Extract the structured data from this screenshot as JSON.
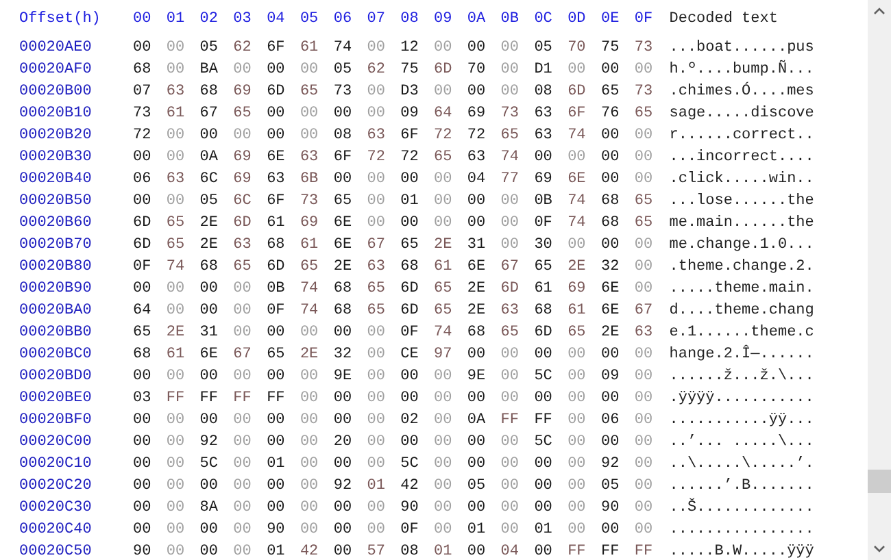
{
  "header": {
    "offset": "Offset(h)",
    "columns": [
      "00",
      "01",
      "02",
      "03",
      "04",
      "05",
      "06",
      "07",
      "08",
      "09",
      "0A",
      "0B",
      "0C",
      "0D",
      "0E",
      "0F"
    ],
    "decoded": "Decoded text"
  },
  "rows": [
    {
      "offset": "00020AE0",
      "bytes": [
        "00",
        "00",
        "05",
        "62",
        "6F",
        "61",
        "74",
        "00",
        "12",
        "00",
        "00",
        "00",
        "05",
        "70",
        "75",
        "73"
      ],
      "text": "...boat......pus"
    },
    {
      "offset": "00020AF0",
      "bytes": [
        "68",
        "00",
        "BA",
        "00",
        "00",
        "00",
        "05",
        "62",
        "75",
        "6D",
        "70",
        "00",
        "D1",
        "00",
        "00",
        "00"
      ],
      "text": "h.º....bump.Ñ..."
    },
    {
      "offset": "00020B00",
      "bytes": [
        "07",
        "63",
        "68",
        "69",
        "6D",
        "65",
        "73",
        "00",
        "D3",
        "00",
        "00",
        "00",
        "08",
        "6D",
        "65",
        "73"
      ],
      "text": ".chimes.Ó....mes"
    },
    {
      "offset": "00020B10",
      "bytes": [
        "73",
        "61",
        "67",
        "65",
        "00",
        "00",
        "00",
        "00",
        "09",
        "64",
        "69",
        "73",
        "63",
        "6F",
        "76",
        "65"
      ],
      "text": "sage.....discove"
    },
    {
      "offset": "00020B20",
      "bytes": [
        "72",
        "00",
        "00",
        "00",
        "00",
        "00",
        "08",
        "63",
        "6F",
        "72",
        "72",
        "65",
        "63",
        "74",
        "00",
        "00"
      ],
      "text": "r......correct.."
    },
    {
      "offset": "00020B30",
      "bytes": [
        "00",
        "00",
        "0A",
        "69",
        "6E",
        "63",
        "6F",
        "72",
        "72",
        "65",
        "63",
        "74",
        "00",
        "00",
        "00",
        "00"
      ],
      "text": "...incorrect...."
    },
    {
      "offset": "00020B40",
      "bytes": [
        "06",
        "63",
        "6C",
        "69",
        "63",
        "6B",
        "00",
        "00",
        "00",
        "00",
        "04",
        "77",
        "69",
        "6E",
        "00",
        "00"
      ],
      "text": ".click.....win.."
    },
    {
      "offset": "00020B50",
      "bytes": [
        "00",
        "00",
        "05",
        "6C",
        "6F",
        "73",
        "65",
        "00",
        "01",
        "00",
        "00",
        "00",
        "0B",
        "74",
        "68",
        "65"
      ],
      "text": "...lose......the"
    },
    {
      "offset": "00020B60",
      "bytes": [
        "6D",
        "65",
        "2E",
        "6D",
        "61",
        "69",
        "6E",
        "00",
        "00",
        "00",
        "00",
        "00",
        "0F",
        "74",
        "68",
        "65"
      ],
      "text": "me.main......the"
    },
    {
      "offset": "00020B70",
      "bytes": [
        "6D",
        "65",
        "2E",
        "63",
        "68",
        "61",
        "6E",
        "67",
        "65",
        "2E",
        "31",
        "00",
        "30",
        "00",
        "00",
        "00"
      ],
      "text": "me.change.1.0..."
    },
    {
      "offset": "00020B80",
      "bytes": [
        "0F",
        "74",
        "68",
        "65",
        "6D",
        "65",
        "2E",
        "63",
        "68",
        "61",
        "6E",
        "67",
        "65",
        "2E",
        "32",
        "00"
      ],
      "text": ".theme.change.2."
    },
    {
      "offset": "00020B90",
      "bytes": [
        "00",
        "00",
        "00",
        "00",
        "0B",
        "74",
        "68",
        "65",
        "6D",
        "65",
        "2E",
        "6D",
        "61",
        "69",
        "6E",
        "00"
      ],
      "text": ".....theme.main."
    },
    {
      "offset": "00020BA0",
      "bytes": [
        "64",
        "00",
        "00",
        "00",
        "0F",
        "74",
        "68",
        "65",
        "6D",
        "65",
        "2E",
        "63",
        "68",
        "61",
        "6E",
        "67"
      ],
      "text": "d....theme.chang"
    },
    {
      "offset": "00020BB0",
      "bytes": [
        "65",
        "2E",
        "31",
        "00",
        "00",
        "00",
        "00",
        "00",
        "0F",
        "74",
        "68",
        "65",
        "6D",
        "65",
        "2E",
        "63"
      ],
      "text": "e.1......theme.c"
    },
    {
      "offset": "00020BC0",
      "bytes": [
        "68",
        "61",
        "6E",
        "67",
        "65",
        "2E",
        "32",
        "00",
        "CE",
        "97",
        "00",
        "00",
        "00",
        "00",
        "00",
        "00"
      ],
      "text": "hange.2.Î—......"
    },
    {
      "offset": "00020BD0",
      "bytes": [
        "00",
        "00",
        "00",
        "00",
        "00",
        "00",
        "9E",
        "00",
        "00",
        "00",
        "9E",
        "00",
        "5C",
        "00",
        "09",
        "00"
      ],
      "text": "......ž...ž.\\..."
    },
    {
      "offset": "00020BE0",
      "bytes": [
        "03",
        "FF",
        "FF",
        "FF",
        "FF",
        "00",
        "00",
        "00",
        "00",
        "00",
        "00",
        "00",
        "00",
        "00",
        "00",
        "00"
      ],
      "text": ".ÿÿÿÿ..........."
    },
    {
      "offset": "00020BF0",
      "bytes": [
        "00",
        "00",
        "00",
        "00",
        "00",
        "00",
        "00",
        "00",
        "02",
        "00",
        "0A",
        "FF",
        "FF",
        "00",
        "06",
        "00"
      ],
      "text": "...........ÿÿ..."
    },
    {
      "offset": "00020C00",
      "bytes": [
        "00",
        "00",
        "92",
        "00",
        "00",
        "00",
        "20",
        "00",
        "00",
        "00",
        "00",
        "00",
        "5C",
        "00",
        "00",
        "00"
      ],
      "text": "..’... .....\\..."
    },
    {
      "offset": "00020C10",
      "bytes": [
        "00",
        "00",
        "5C",
        "00",
        "01",
        "00",
        "00",
        "00",
        "5C",
        "00",
        "00",
        "00",
        "00",
        "00",
        "92",
        "00"
      ],
      "text": "..\\.....\\.....’."
    },
    {
      "offset": "00020C20",
      "bytes": [
        "00",
        "00",
        "00",
        "00",
        "00",
        "00",
        "92",
        "01",
        "42",
        "00",
        "05",
        "00",
        "00",
        "00",
        "05",
        "00"
      ],
      "text": "......’.B......."
    },
    {
      "offset": "00020C30",
      "bytes": [
        "00",
        "00",
        "8A",
        "00",
        "00",
        "00",
        "00",
        "00",
        "90",
        "00",
        "00",
        "00",
        "00",
        "00",
        "90",
        "00"
      ],
      "text": "..Š............."
    },
    {
      "offset": "00020C40",
      "bytes": [
        "00",
        "00",
        "00",
        "00",
        "90",
        "00",
        "00",
        "00",
        "0F",
        "00",
        "01",
        "00",
        "01",
        "00",
        "00",
        "00"
      ],
      "text": "................"
    },
    {
      "offset": "00020C50",
      "bytes": [
        "90",
        "00",
        "00",
        "00",
        "01",
        "42",
        "00",
        "57",
        "08",
        "01",
        "00",
        "04",
        "00",
        "FF",
        "FF",
        "FF"
      ],
      "text": ".....B.W.....ÿÿÿ"
    }
  ]
}
